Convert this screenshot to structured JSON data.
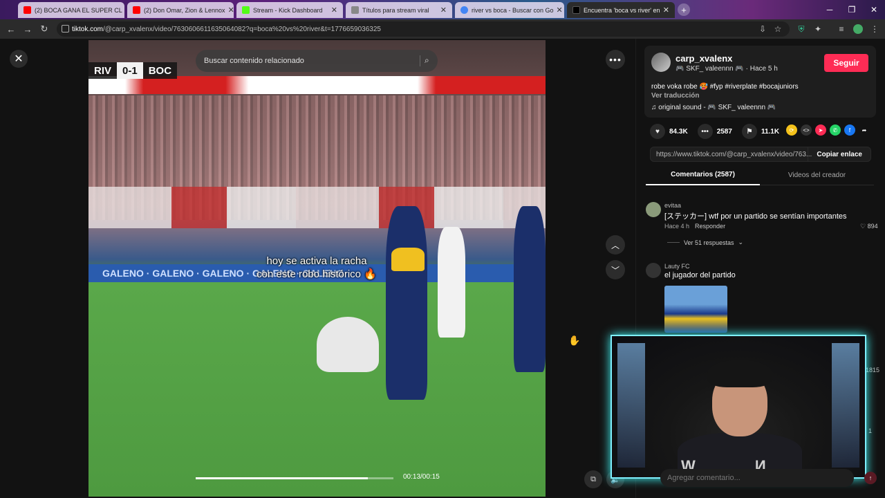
{
  "browser": {
    "tabs": [
      {
        "title": "(2) BOCA GANA EL SUPER CL",
        "favicon_color": "#ff0000"
      },
      {
        "title": "(2) Don Omar, Zion & Lennox",
        "favicon_color": "#ff0000"
      },
      {
        "title": "Stream - Kick Dashboard",
        "favicon_color": "#53fc18"
      },
      {
        "title": "Títulos para stream viral",
        "favicon_color": "#888888"
      },
      {
        "title": "river vs boca - Buscar con Go",
        "favicon_color": "#4285f4"
      },
      {
        "title": "Encuentra 'boca vs river' en",
        "favicon_color": "#000000"
      }
    ],
    "url_domain": "tiktok.com",
    "url_path": "/@carp_xvalenx/video/7630606611635064082?q=boca%20vs%20river&t=1776659036325"
  },
  "video": {
    "search_placeholder": "Buscar contenido relacionado",
    "scoreboard": {
      "home": "RIV",
      "score": "0-1",
      "away": "BOC"
    },
    "caption_line1": "hoy se activa la racha",
    "caption_line2": "con este robo histórico 🔥",
    "adboard_text": "GALENO · GALENO · GALENO · GALENO · GALENO",
    "time": "00:13/00:15",
    "progress_fraction": 0.87
  },
  "creator": {
    "username": "carp_xvalenx",
    "subline": "🎮 SKF_ valeennn 🎮 · Hace 5 h",
    "follow_label": "Seguir",
    "description": "robe voka robe 🥵 #fyp #riverplate #bocajuniors",
    "translate_label": "Ver traducción",
    "sound": "original sound - 🎮 SKF_ valeennn 🎮"
  },
  "stats": {
    "likes": "84.3K",
    "comments": "2587",
    "saves": "11.1K"
  },
  "share_colors": [
    "#f4c21b",
    "#333333",
    "#fe2c55",
    "#25d366",
    "#1877f2"
  ],
  "link": {
    "url": "https://www.tiktok.com/@carp_xvalenx/video/763...",
    "copy_label": "Copiar enlace"
  },
  "panel_tabs": {
    "comments": "Comentarios (2587)",
    "creator_videos": "Videos del creador"
  },
  "comments": [
    {
      "user": "evitaa",
      "text": "[ステッカー] wtf por un partido se sentían importantes",
      "time": "Hace 4 h",
      "reply_label": "Responder",
      "likes": "894",
      "replies": "Ver 51 respuestas"
    },
    {
      "user": "Lauty FC",
      "text": "el jugador del partido"
    }
  ],
  "side_counts": {
    "c1": "1815",
    "c2": "1"
  },
  "add_comment_placeholder": "Agregar comentario...",
  "webcam_watermark": "W  И"
}
